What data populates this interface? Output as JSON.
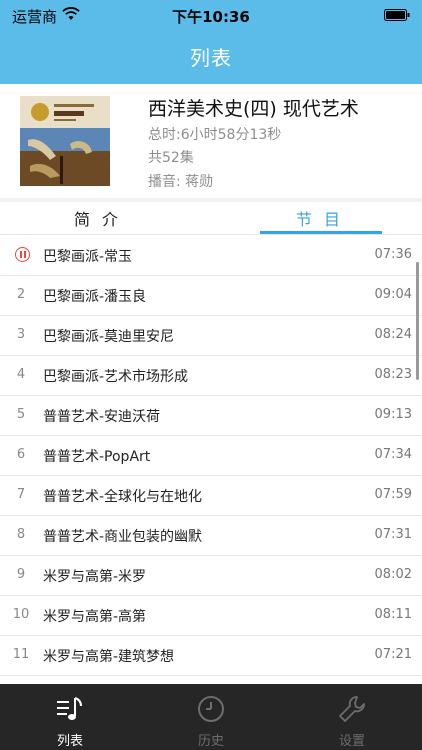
{
  "status_bar": {
    "carrier": "运营商",
    "time": "下午10:36"
  },
  "nav": {
    "title": "列表"
  },
  "album": {
    "title": "西洋美术史(四) 现代艺术",
    "duration": "总时:6小时58分13秒",
    "episode_count": "共52集",
    "host": "播音:  蒋勋"
  },
  "tabs": [
    {
      "label": "简介"
    },
    {
      "label": "节目"
    }
  ],
  "episodes": [
    {
      "index": "",
      "title": "巴黎画派-常玉",
      "duration": "07:36",
      "playing": true
    },
    {
      "index": "2",
      "title": "巴黎画派-潘玉良",
      "duration": "09:04"
    },
    {
      "index": "3",
      "title": "巴黎画派-莫迪里安尼",
      "duration": "08:24"
    },
    {
      "index": "4",
      "title": "巴黎画派-艺术市场形成",
      "duration": "08:23"
    },
    {
      "index": "5",
      "title": "普普艺术-安迪沃荷",
      "duration": "09:13"
    },
    {
      "index": "6",
      "title": "普普艺术-PopArt",
      "duration": "07:34"
    },
    {
      "index": "7",
      "title": "普普艺术-全球化与在地化",
      "duration": "07:59"
    },
    {
      "index": "8",
      "title": "普普艺术-商业包装的幽默",
      "duration": "07:31"
    },
    {
      "index": "9",
      "title": "米罗与高第-米罗",
      "duration": "08:02"
    },
    {
      "index": "10",
      "title": "米罗与高第-高第",
      "duration": "08:11"
    },
    {
      "index": "11",
      "title": "米罗与高第-建筑梦想",
      "duration": "07:21"
    }
  ],
  "tabbar": [
    {
      "label": "列表",
      "icon": "music-list-icon",
      "active": true
    },
    {
      "label": "历史",
      "icon": "clock-icon",
      "active": false
    },
    {
      "label": "设置",
      "icon": "wrench-icon",
      "active": false
    }
  ],
  "colors": {
    "nav_background": "#5bbbe9",
    "accent": "#3aa3de",
    "playing_indicator": "#e64a3b",
    "tabbar_background": "#141414"
  }
}
